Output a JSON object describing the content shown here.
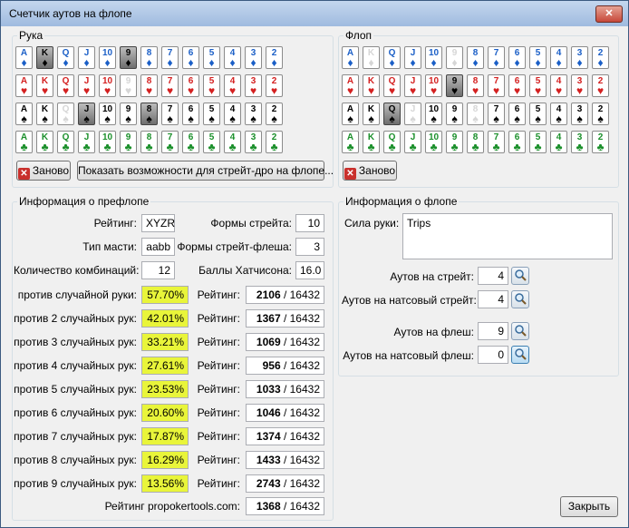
{
  "window": {
    "title": "Счетчик аутов на флопе",
    "close_label": "✕"
  },
  "hand_group": {
    "title": "Рука",
    "reset_label": "Заново",
    "straight_draw_button": "Показать возможности для стрейт-дро на флопе..."
  },
  "flop_group": {
    "title": "Флоп",
    "reset_label": "Заново"
  },
  "ranks": [
    "A",
    "K",
    "Q",
    "J",
    "10",
    "9",
    "8",
    "7",
    "6",
    "5",
    "4",
    "3",
    "2"
  ],
  "suits": [
    {
      "name": "diamonds",
      "glyph": "♦",
      "color": "#1b5fc7"
    },
    {
      "name": "hearts",
      "glyph": "♥",
      "color": "#d42020"
    },
    {
      "name": "spades",
      "glyph": "♠",
      "color": "#000000"
    },
    {
      "name": "clubs",
      "glyph": "♣",
      "color": "#1a8f2a"
    }
  ],
  "hand_selected": [
    [
      0,
      1
    ],
    [
      0,
      5
    ],
    [
      2,
      3
    ],
    [
      2,
      6
    ]
  ],
  "hand_dimmed": [
    [
      1,
      5
    ],
    [
      2,
      2
    ]
  ],
  "flop_selected": [
    [
      1,
      5
    ],
    [
      2,
      2
    ]
  ],
  "flop_dimmed": [
    [
      0,
      1
    ],
    [
      0,
      5
    ],
    [
      2,
      3
    ],
    [
      2,
      6
    ]
  ],
  "preflop": {
    "title": "Информация о префлопе",
    "rating_label": "Рейтинг:",
    "rating_value": "XYZR",
    "suit_type_label": "Тип масти:",
    "suit_type_value": "aabb",
    "combos_label": "Количество комбинаций:",
    "combos_value": "12",
    "straight_forms_label": "Формы стрейта:",
    "straight_forms_value": "10",
    "flush_forms_label": "Формы стрейт-флеша:",
    "flush_forms_value": "3",
    "hutchison_label": "Баллы Хатчисона:",
    "hutchison_value": "16.0",
    "rows": [
      {
        "label": "против случайной руки:",
        "pct": "57.70%",
        "rating_label": "Рейтинг:",
        "rank": "2106",
        "total": " / 16432"
      },
      {
        "label": "против 2 случайных рук:",
        "pct": "42.01%",
        "rating_label": "Рейтинг:",
        "rank": "1367",
        "total": " / 16432"
      },
      {
        "label": "против 3 случайных рук:",
        "pct": "33.21%",
        "rating_label": "Рейтинг:",
        "rank": "1069",
        "total": " / 16432"
      },
      {
        "label": "против 4 случайных рук:",
        "pct": "27.61%",
        "rating_label": "Рейтинг:",
        "rank": "956",
        "total": " / 16432"
      },
      {
        "label": "против 5 случайных рук:",
        "pct": "23.53%",
        "rating_label": "Рейтинг:",
        "rank": "1033",
        "total": " / 16432"
      },
      {
        "label": "против 6 случайных рук:",
        "pct": "20.60%",
        "rating_label": "Рейтинг:",
        "rank": "1046",
        "total": " / 16432"
      },
      {
        "label": "против 7 случайных рук:",
        "pct": "17.87%",
        "rating_label": "Рейтинг:",
        "rank": "1374",
        "total": " / 16432"
      },
      {
        "label": "против 8 случайных рук:",
        "pct": "16.29%",
        "rating_label": "Рейтинг:",
        "rank": "1433",
        "total": " / 16432"
      },
      {
        "label": "против 9 случайных рук:",
        "pct": "13.56%",
        "rating_label": "Рейтинг:",
        "rank": "2743",
        "total": " / 16432"
      }
    ],
    "propoker_label": "Рейтинг propokertools.com:",
    "propoker_rank": "1368",
    "propoker_total": " / 16432"
  },
  "flop_info": {
    "title": "Информация о флопе",
    "strength_label": "Сила руки:",
    "strength_value": "Trips",
    "outs_straight_label": "Аутов на стрейт:",
    "outs_straight_value": "4",
    "outs_nut_straight_label": "Аутов на натсовый стрейт:",
    "outs_nut_straight_value": "4",
    "outs_flush_label": "Аутов на флеш:",
    "outs_flush_value": "9",
    "outs_nut_flush_label": "Аутов на натсовый флеш:",
    "outs_nut_flush_value": "0"
  },
  "close_button": "Закрыть"
}
